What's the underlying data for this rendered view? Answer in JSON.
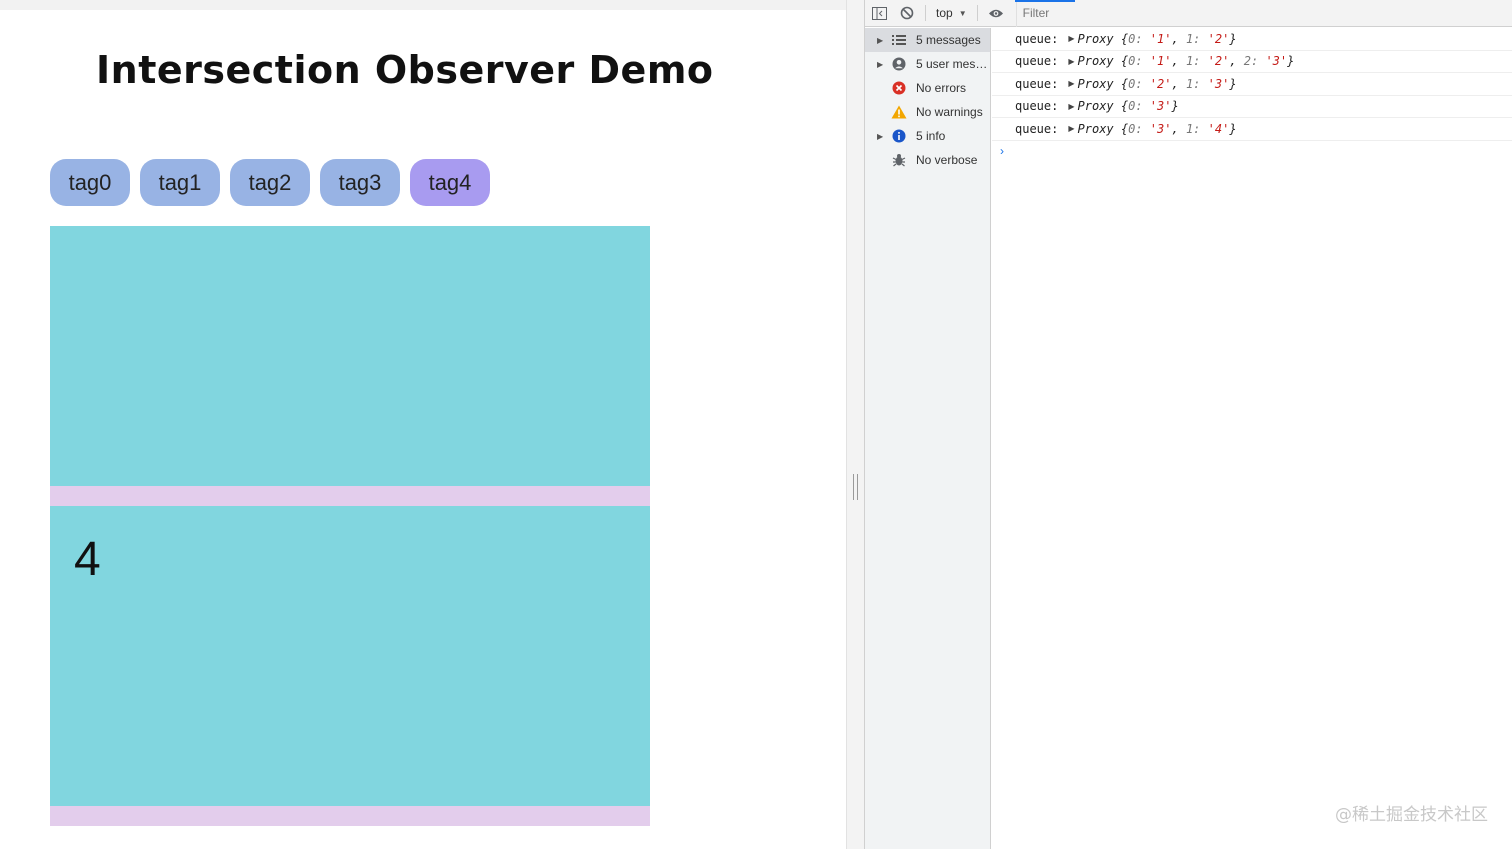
{
  "page": {
    "title": "Intersection Observer Demo",
    "tags": [
      {
        "label": "tag0"
      },
      {
        "label": "tag1"
      },
      {
        "label": "tag2"
      },
      {
        "label": "tag3"
      },
      {
        "label": "tag4"
      }
    ],
    "active_tag": "tag4",
    "section_label": "4",
    "colors": {
      "tag": "#98b3e4",
      "tag_active": "#a89bf0",
      "section": "#81d6df",
      "spacer": "#e3cdec"
    }
  },
  "devtools": {
    "toolbar": {
      "sidebar_toggle_icon": "sidebar-toggle-icon",
      "clear_icon": "clear-console-icon",
      "context": "top",
      "eye_icon": "eye-icon",
      "filter_placeholder": "Filter"
    },
    "sidebar": {
      "items": [
        {
          "label": "5 messages",
          "icon": "list-icon",
          "expandable": true
        },
        {
          "label": "5 user mes…",
          "icon": "user-icon",
          "expandable": true
        },
        {
          "label": "No errors",
          "icon": "error-icon",
          "expandable": false
        },
        {
          "label": "No warnings",
          "icon": "warning-icon",
          "expandable": false
        },
        {
          "label": "5 info",
          "icon": "info-icon",
          "expandable": true
        },
        {
          "label": "No verbose",
          "icon": "bug-icon",
          "expandable": false
        }
      ]
    },
    "logs": [
      {
        "key": "queue:",
        "type": "Proxy",
        "entries": [
          {
            "k": "0",
            "v": "'1'"
          },
          {
            "k": "1",
            "v": "'2'"
          }
        ]
      },
      {
        "key": "queue:",
        "type": "Proxy",
        "entries": [
          {
            "k": "0",
            "v": "'1'"
          },
          {
            "k": "1",
            "v": "'2'"
          },
          {
            "k": "2",
            "v": "'3'"
          }
        ]
      },
      {
        "key": "queue:",
        "type": "Proxy",
        "entries": [
          {
            "k": "0",
            "v": "'2'"
          },
          {
            "k": "1",
            "v": "'3'"
          }
        ]
      },
      {
        "key": "queue:",
        "type": "Proxy",
        "entries": [
          {
            "k": "0",
            "v": "'3'"
          }
        ]
      },
      {
        "key": "queue:",
        "type": "Proxy",
        "entries": [
          {
            "k": "0",
            "v": "'3'"
          },
          {
            "k": "1",
            "v": "'4'"
          }
        ]
      }
    ],
    "prompt": "›"
  },
  "watermark": "@稀土掘金技术社区"
}
